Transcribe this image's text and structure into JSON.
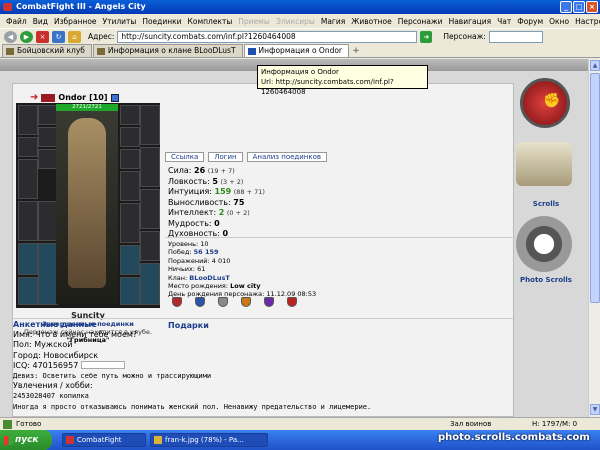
{
  "window": {
    "title": "CombatFight III - Angels City",
    "min": "_",
    "max": "□",
    "close": "×"
  },
  "menu": [
    "Файл",
    "Вид",
    "Избранное",
    "Утилиты",
    "Поединки",
    "Комплекты",
    "Приемы",
    "Эликсиры",
    "Магия",
    "Животное",
    "Персонажи",
    "Навигация",
    "Чат",
    "Форум",
    "Окно",
    "Настройки",
    "?"
  ],
  "menu_disabled": [
    6,
    7
  ],
  "toolbar": {
    "address_label": "Адрес:",
    "url": "http://suncity.combats.com/inf.pl?1260464008",
    "person_label": "Персонаж:"
  },
  "tabs": [
    {
      "label": "Бойцовский клуб"
    },
    {
      "label": "Информация о клане BLooDLusT"
    },
    {
      "label": "Информация о Ondor",
      "active": true
    }
  ],
  "tooltip": {
    "line1": "Информация о Ondor",
    "line2": "Url: http://suncity.combats.com/inf.pl?1260464008"
  },
  "character": {
    "name": "Ondor",
    "level": "[10]",
    "hp": "2721/2721",
    "nick_under": "Suncity",
    "finished_fights": "Завершенные поединки",
    "location_text": "Персонаж сейчас находится в клубе.",
    "location": "\"Грибница\""
  },
  "actions": [
    "Ссылка",
    "Логин",
    "Анализ поединков"
  ],
  "stats": [
    {
      "label": "Сила:",
      "value": "26",
      "extra": "(19 + 7)"
    },
    {
      "label": "Ловкость:",
      "value": "5",
      "extra": "(3 + 2)"
    },
    {
      "label": "Интуиция:",
      "value": "159",
      "extra": "(88 + 71)",
      "green": true
    },
    {
      "label": "Выносливость:",
      "value": "75",
      "extra": ""
    },
    {
      "label": "Интеллект:",
      "value": "2",
      "extra": "(0 + 2)",
      "green": true
    },
    {
      "label": "Мудрость:",
      "value": "0",
      "extra": ""
    },
    {
      "label": "Духовность:",
      "value": "0",
      "extra": ""
    }
  ],
  "info": {
    "level": "Уровень: 10",
    "wins_label": "Побед:",
    "wins": "56 159",
    "losses": "Поражений: 4 010",
    "draws": "Ничьих: 61",
    "clan_label": "Клан:",
    "clan": "BLooDLusT",
    "birthplace_label": "Место рождения:",
    "birthplace": "Low city",
    "birthday": "День рождения персонажа: 11.12.09 08:53"
  },
  "gifts_label": "Подарки",
  "profile": {
    "heading": "Анкетные данные",
    "name": "Имя: Что в имени тебе моем?",
    "sex": "Пол: Мужской",
    "city": "Город: Новосибирск",
    "icq": "ICQ: 470156957",
    "motto": "Девиз: Осветить себе путь можно и трассирующими",
    "hobby_label": "Увлечения / хобби:",
    "hobby1": "2453028407 копилка",
    "hobby2": "Иногда я просто отказываюсь понимать женский пол. Ненавижу предательство и лицемерие."
  },
  "side": {
    "scrolls_label": "Scrolls",
    "photo_label": "Photo Scrolls"
  },
  "status": {
    "ready": "Готово",
    "zone": "Зал воинов",
    "memory": "Н: 1797/М: 0"
  },
  "taskbar": {
    "start": "пуск",
    "tasks": [
      "CombatFight",
      "fran-k.jpg (78%) - Pa..."
    ],
    "watermark": "photo.scrolls.combats.com"
  }
}
